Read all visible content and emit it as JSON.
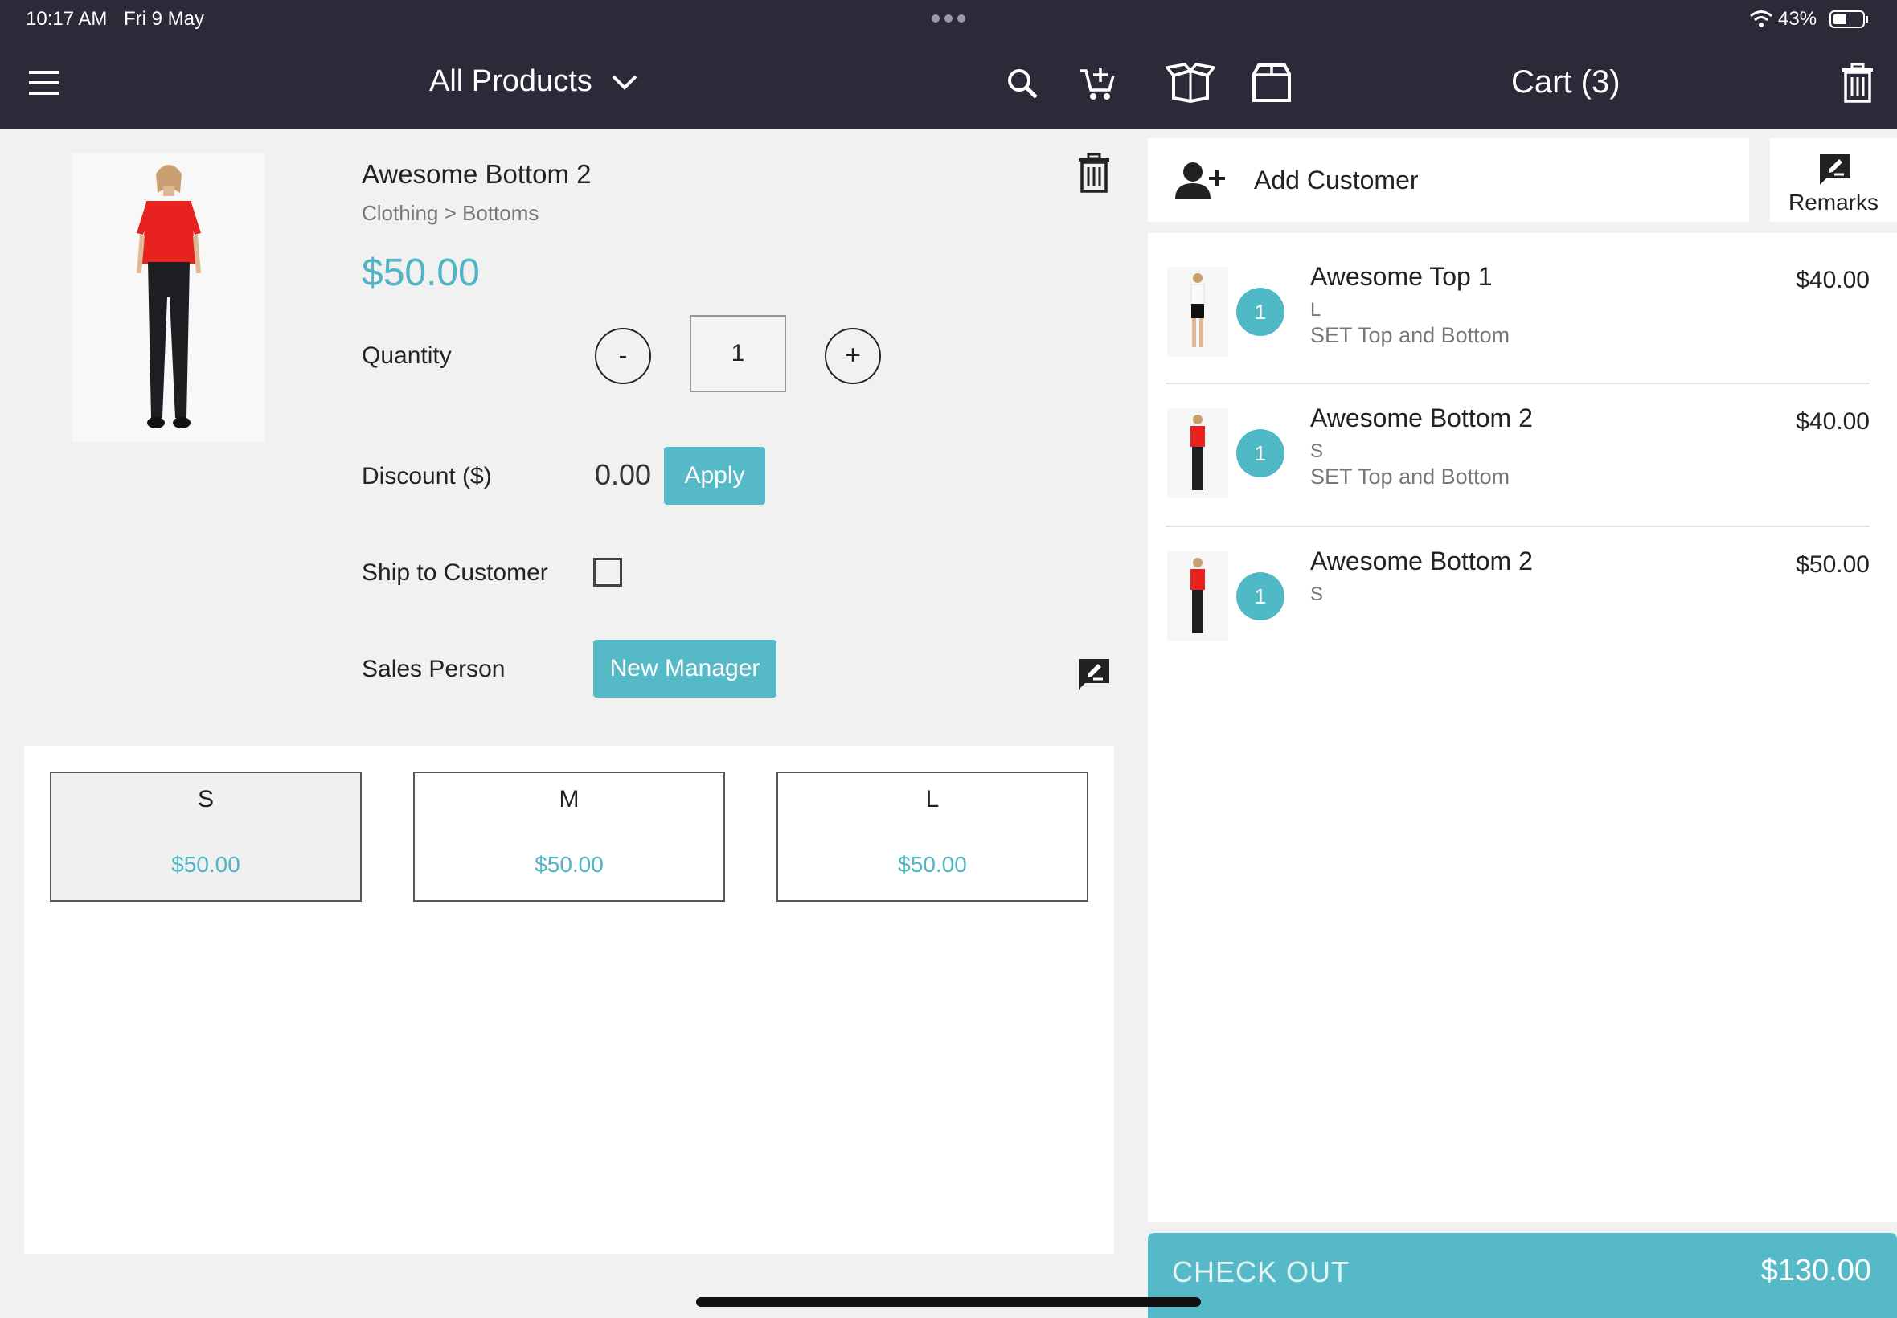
{
  "status_bar": {
    "time": "10:17 AM",
    "date": "Fri 9 May",
    "battery": "43%"
  },
  "header": {
    "title": "All Products",
    "cart_title": "Cart (3)"
  },
  "product": {
    "name": "Awesome Bottom 2",
    "category": "Clothing > Bottoms",
    "price": "$50.00",
    "quantity_label": "Quantity",
    "quantity_value": "1",
    "minus_label": "-",
    "plus_label": "+",
    "discount_label": "Discount ($)",
    "discount_value": "0.00",
    "apply_label": "Apply",
    "ship_label": "Ship to Customer",
    "sales_person_label": "Sales Person",
    "sales_person_value": "New Manager"
  },
  "variants": [
    {
      "size": "S",
      "price": "$50.00"
    },
    {
      "size": "M",
      "price": "$50.00"
    },
    {
      "size": "L",
      "price": "$50.00"
    }
  ],
  "customer": {
    "add_label": "Add Customer",
    "remarks_label": "Remarks"
  },
  "cart_items": [
    {
      "name": "Awesome Top 1",
      "variant": "L",
      "set": "SET Top and Bottom",
      "qty": "1",
      "price": "$40.00"
    },
    {
      "name": "Awesome Bottom 2",
      "variant": "S",
      "set": "SET Top and Bottom",
      "qty": "1",
      "price": "$40.00"
    },
    {
      "name": "Awesome Bottom 2",
      "variant": "S",
      "set": "",
      "qty": "1",
      "price": "$50.00"
    }
  ],
  "checkout": {
    "label": "CHECK OUT",
    "total": "$130.00"
  },
  "colors": {
    "header_bg": "#2a2a39",
    "accent": "#56b9c8"
  },
  "icons": [
    "menu-icon",
    "chevron-down-icon",
    "search-icon",
    "add-to-cart-icon",
    "open-box-icon",
    "box-icon",
    "trash-icon",
    "add-person-icon",
    "remarks-icon",
    "wifi-icon",
    "battery-icon",
    "multitask-dots-icon"
  ]
}
